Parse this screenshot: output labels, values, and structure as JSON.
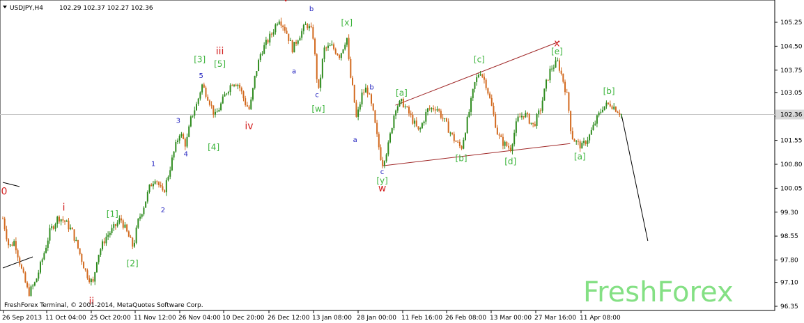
{
  "header": {
    "symbol": "USDJPY,H4",
    "ohlc": "102.29 102.37 102.27 102.36"
  },
  "footer": {
    "copyright": "FreshForex Terminal, © 2001-2014, MetaQuotes Software Corp."
  },
  "watermark": "FreshForex",
  "colors": {
    "up_candle": "#2e8b1e",
    "down_candle": "#d2691e",
    "label_green": "#3cb43c",
    "label_blue": "#1e1ebe",
    "label_red": "#d21e1e",
    "trendline": "#a02828",
    "projection": "#000000",
    "current_price_line": "#c8c8c8",
    "price_badge_bg": "#d9d9d9"
  },
  "chart_data": {
    "type": "candlestick",
    "symbol": "USDJPY",
    "timeframe": "H4",
    "current_price": 102.36,
    "y_ticks": [
      "105.25",
      "104.50",
      "103.75",
      "103.05",
      "102.30",
      "101.55",
      "100.80",
      "100.05",
      "99.30",
      "98.55",
      "97.80",
      "97.10",
      "96.35"
    ],
    "ylim": [
      96.35,
      105.9
    ],
    "x_ticks": [
      "26 Sep 2013",
      "11 Oct 04:00",
      "25 Oct 20:00",
      "11 Nov 12:00",
      "26 Nov 04:00",
      "10 Dec 20:00",
      "26 Dec 12:00",
      "13 Jan 08:00",
      "28 Jan 00:00",
      "11 Feb 16:00",
      "26 Feb 08:00",
      "13 Mar 00:00",
      "27 Mar 16:00",
      "11 Apr 08:00"
    ],
    "price_path": [
      [
        0,
        99.1
      ],
      [
        9,
        98.2
      ],
      [
        17,
        98.4
      ],
      [
        27,
        97.5
      ],
      [
        37,
        96.75
      ],
      [
        47,
        97.1
      ],
      [
        58,
        97.9
      ],
      [
        68,
        98.7
      ],
      [
        80,
        99.15
      ],
      [
        90,
        99.0
      ],
      [
        100,
        98.7
      ],
      [
        108,
        98.2
      ],
      [
        120,
        97.4
      ],
      [
        130,
        97.05
      ],
      [
        136,
        97.9
      ],
      [
        148,
        98.5
      ],
      [
        160,
        98.8
      ],
      [
        170,
        99.1
      ],
      [
        180,
        98.6
      ],
      [
        188,
        98.2
      ],
      [
        195,
        99.0
      ],
      [
        205,
        99.6
      ],
      [
        212,
        100.1
      ],
      [
        220,
        100.4
      ],
      [
        231,
        99.85
      ],
      [
        239,
        100.5
      ],
      [
        247,
        101.2
      ],
      [
        255,
        101.8
      ],
      [
        264,
        101.4
      ],
      [
        272,
        102.3
      ],
      [
        280,
        102.7
      ],
      [
        287,
        103.3
      ],
      [
        296,
        102.9
      ],
      [
        306,
        102.3
      ],
      [
        313,
        102.6
      ],
      [
        323,
        103.1
      ],
      [
        332,
        103.4
      ],
      [
        340,
        103.3
      ],
      [
        350,
        102.7
      ],
      [
        356,
        102.5
      ],
      [
        364,
        103.6
      ],
      [
        372,
        104.3
      ],
      [
        380,
        104.6
      ],
      [
        388,
        104.9
      ],
      [
        398,
        105.4
      ],
      [
        408,
        105.0
      ],
      [
        418,
        104.4
      ],
      [
        425,
        104.75
      ],
      [
        438,
        105.2
      ],
      [
        447,
        104.9
      ],
      [
        455,
        103.0
      ],
      [
        463,
        104.4
      ],
      [
        474,
        104.5
      ],
      [
        486,
        104.2
      ],
      [
        496,
        104.8
      ],
      [
        500,
        103.7
      ],
      [
        505,
        103.1
      ],
      [
        510,
        102.2
      ],
      [
        518,
        103.0
      ],
      [
        525,
        103.2
      ],
      [
        534,
        102.4
      ],
      [
        540,
        101.6
      ],
      [
        547,
        100.8
      ],
      [
        556,
        101.4
      ],
      [
        566,
        102.6
      ],
      [
        576,
        102.75
      ],
      [
        588,
        102.3
      ],
      [
        600,
        101.8
      ],
      [
        612,
        102.5
      ],
      [
        625,
        102.6
      ],
      [
        638,
        102.1
      ],
      [
        650,
        101.6
      ],
      [
        661,
        101.3
      ],
      [
        672,
        102.4
      ],
      [
        680,
        103.3
      ],
      [
        688,
        103.75
      ],
      [
        697,
        103.3
      ],
      [
        706,
        102.5
      ],
      [
        714,
        101.7
      ],
      [
        722,
        101.45
      ],
      [
        732,
        101.3
      ],
      [
        742,
        102.2
      ],
      [
        752,
        102.4
      ],
      [
        765,
        102.0
      ],
      [
        775,
        102.5
      ],
      [
        783,
        103.3
      ],
      [
        790,
        103.8
      ],
      [
        800,
        104.0
      ],
      [
        807,
        103.5
      ],
      [
        814,
        102.9
      ],
      [
        820,
        101.7
      ],
      [
        826,
        101.5
      ],
      [
        835,
        101.35
      ],
      [
        846,
        101.7
      ],
      [
        856,
        102.2
      ],
      [
        865,
        102.6
      ],
      [
        876,
        102.7
      ],
      [
        886,
        102.5
      ],
      [
        892,
        102.36
      ]
    ],
    "candle_count": 330,
    "wave_labels": [
      {
        "text": "0",
        "color": "red",
        "price": 99.85,
        "pos": 2
      },
      {
        "text": "i",
        "color": "red",
        "price": 99.35,
        "pos": 88
      },
      {
        "text": "ii",
        "color": "red",
        "price": 96.4,
        "pos": 128
      },
      {
        "text": "iii",
        "color": "red",
        "price": 104.25,
        "pos": 313
      },
      {
        "text": "iv",
        "color": "red",
        "price": 101.9,
        "pos": 355
      },
      {
        "text": "v",
        "color": "red",
        "price": 105.9,
        "pos": 408
      },
      {
        "text": "w",
        "color": "red",
        "price": 99.95,
        "pos": 547
      },
      {
        "text": "x",
        "color": "red",
        "price": 104.5,
        "pos": 799
      },
      {
        "text": "1",
        "color": "blue",
        "price": 100.75,
        "pos": 217
      },
      {
        "text": "2",
        "color": "blue",
        "price": 99.3,
        "pos": 231
      },
      {
        "text": "3",
        "color": "blue",
        "price": 102.1,
        "pos": 253
      },
      {
        "text": "4",
        "color": "blue",
        "price": 101.05,
        "pos": 264
      },
      {
        "text": "5",
        "color": "blue",
        "price": 103.5,
        "pos": 286
      },
      {
        "text": "a",
        "color": "blue",
        "price": 103.65,
        "pos": 420
      },
      {
        "text": "b",
        "color": "blue",
        "price": 105.6,
        "pos": 445
      },
      {
        "text": "c",
        "color": "blue",
        "price": 102.9,
        "pos": 453
      },
      {
        "text": "a",
        "color": "blue",
        "price": 101.5,
        "pos": 508
      },
      {
        "text": "b",
        "color": "blue",
        "price": 103.15,
        "pos": 532
      },
      {
        "text": "c",
        "color": "blue",
        "price": 100.5,
        "pos": 547
      },
      {
        "text": "[1]",
        "color": "green",
        "price": 99.15,
        "pos": 158
      },
      {
        "text": "[2]",
        "color": "green",
        "price": 97.6,
        "pos": 187
      },
      {
        "text": "[3]",
        "color": "green",
        "price": 104.0,
        "pos": 284
      },
      {
        "text": "[4]",
        "color": "green",
        "price": 101.25,
        "pos": 304
      },
      {
        "text": "[5]",
        "color": "green",
        "price": 103.85,
        "pos": 313
      },
      {
        "text": "[w]",
        "color": "green",
        "price": 102.45,
        "pos": 455
      },
      {
        "text": "[x]",
        "color": "green",
        "price": 105.15,
        "pos": 496
      },
      {
        "text": "[y]",
        "color": "green",
        "price": 100.2,
        "pos": 547
      },
      {
        "text": "[a]",
        "color": "green",
        "price": 102.95,
        "pos": 575
      },
      {
        "text": "[b]",
        "color": "green",
        "price": 100.9,
        "pos": 661
      },
      {
        "text": "[c]",
        "color": "green",
        "price": 104.0,
        "pos": 687
      },
      {
        "text": "[d]",
        "color": "green",
        "price": 100.8,
        "pos": 732
      },
      {
        "text": "[e]",
        "color": "green",
        "price": 104.25,
        "pos": 799
      },
      {
        "text": "[a]",
        "color": "green",
        "price": 100.95,
        "pos": 832
      },
      {
        "text": "[b]",
        "color": "green",
        "price": 103.0,
        "pos": 874
      }
    ],
    "trendlines": [
      {
        "name": "upper-triangle-line",
        "from": [
          566,
          102.65
        ],
        "to": [
          803,
          104.65
        ]
      },
      {
        "name": "lower-triangle-line",
        "from": [
          547,
          100.75
        ],
        "to": [
          818,
          101.45
        ]
      }
    ],
    "projection": {
      "from": [
        892,
        102.36
      ],
      "to": [
        930,
        98.4
      ]
    }
  }
}
